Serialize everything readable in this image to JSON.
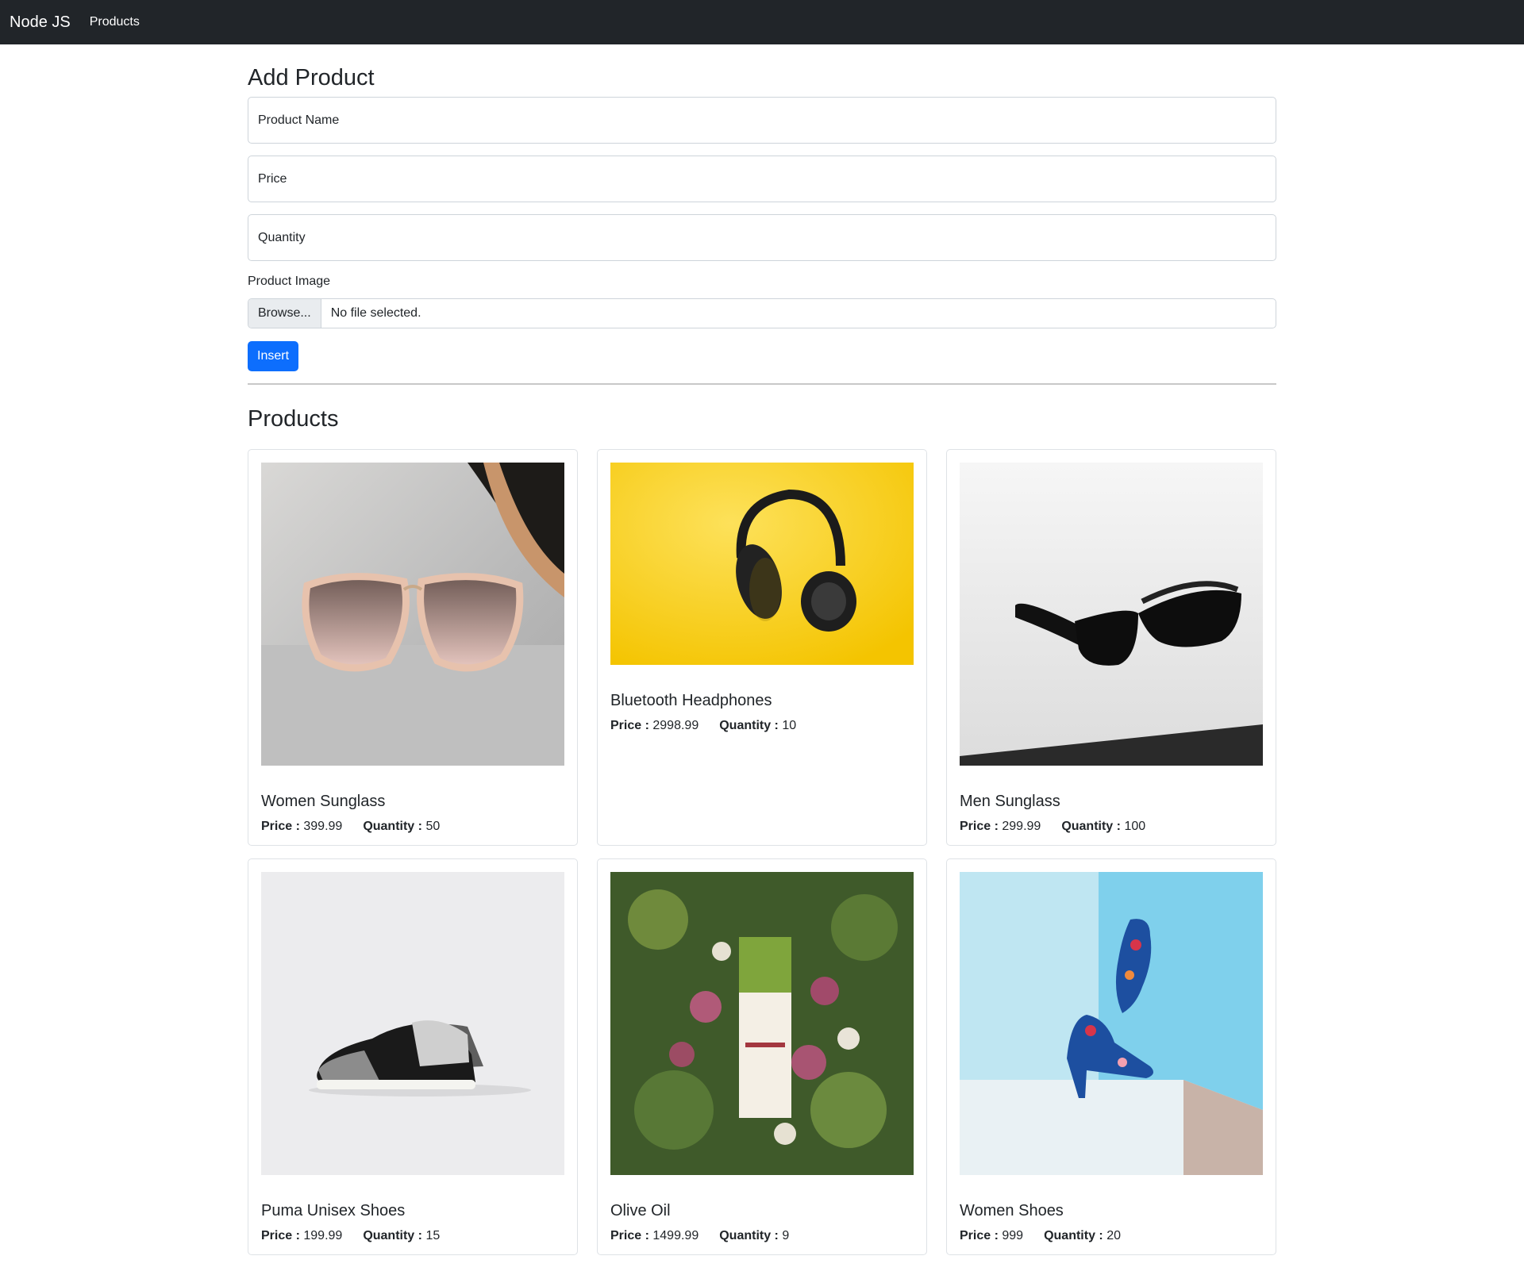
{
  "navbar": {
    "brand": "Node JS",
    "link": "Products"
  },
  "form": {
    "title": "Add Product",
    "product_name_placeholder": "Product Name",
    "price_placeholder": "Price",
    "quantity_placeholder": "Quantity",
    "image_label": "Product Image",
    "browse_label": "Browse...",
    "file_status": "No file selected.",
    "insert_label": "Insert"
  },
  "products_title": "Products",
  "price_label": "Price :",
  "quantity_label": "Quantity :",
  "products": [
    {
      "name": "Women Sunglass",
      "price": "399.99",
      "quantity": "50"
    },
    {
      "name": "Bluetooth Headphones",
      "price": "2998.99",
      "quantity": "10"
    },
    {
      "name": "Men Sunglass",
      "price": "299.99",
      "quantity": "100"
    },
    {
      "name": "Puma Unisex Shoes",
      "price": "199.99",
      "quantity": "15"
    },
    {
      "name": "Olive Oil",
      "price": "1499.99",
      "quantity": "9"
    },
    {
      "name": "Women Shoes",
      "price": "999",
      "quantity": "20"
    }
  ],
  "colors": {
    "navbar": "#212529",
    "primary": "#0d6efd"
  }
}
